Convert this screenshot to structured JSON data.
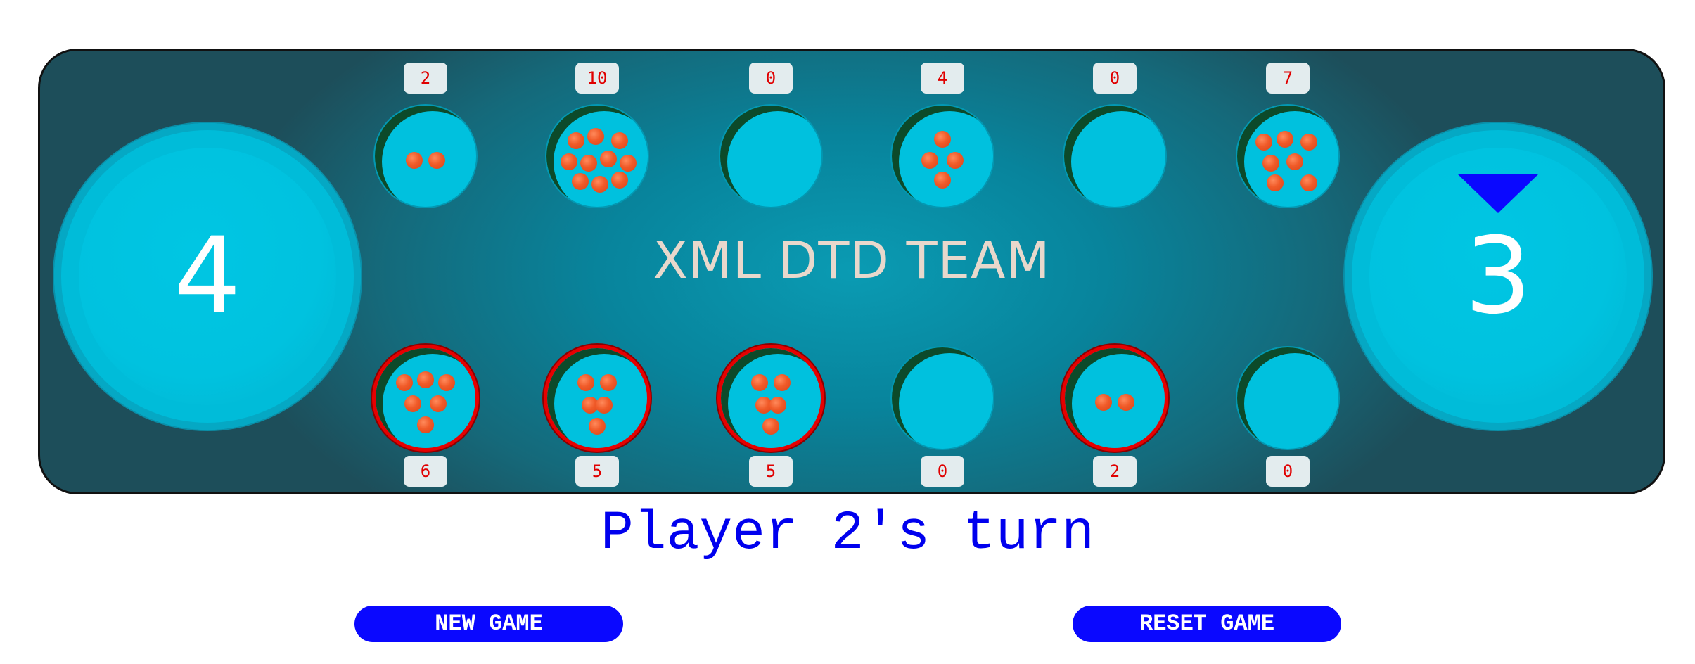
{
  "game": {
    "team_label": "XML DTD TEAM",
    "turn_text": "Player 2's turn",
    "buttons": {
      "new_game": "NEW GAME",
      "reset_game": "RESET GAME"
    },
    "stores": {
      "left_score": "4",
      "right_score": "3"
    },
    "turn_indicator": "right-store",
    "top_pits": [
      {
        "count": "2",
        "seeds": 2
      },
      {
        "count": "10",
        "seeds": 10
      },
      {
        "count": "0",
        "seeds": 0
      },
      {
        "count": "4",
        "seeds": 4
      },
      {
        "count": "0",
        "seeds": 0
      },
      {
        "count": "7",
        "seeds": 7
      }
    ],
    "bottom_pits": [
      {
        "count": "6",
        "seeds": 6,
        "highlighted": true
      },
      {
        "count": "5",
        "seeds": 5,
        "highlighted": true
      },
      {
        "count": "5",
        "seeds": 5,
        "highlighted": true
      },
      {
        "count": "0",
        "seeds": 0,
        "highlighted": false
      },
      {
        "count": "2",
        "seeds": 2,
        "highlighted": true
      },
      {
        "count": "0",
        "seeds": 0,
        "highlighted": false
      }
    ],
    "colors": {
      "seed": "#f05a28",
      "highlight": "#e60000",
      "turn_text": "#0000ee",
      "button": "#0a08ff"
    }
  }
}
